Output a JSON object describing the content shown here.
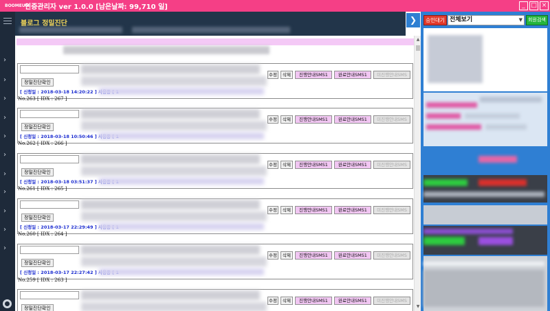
{
  "window": {
    "title": "인증관리자 ver 1.0.0 [남은날짜: 99,710 일]",
    "controls": {
      "minimize": "_",
      "maximize": "□",
      "close": "×"
    }
  },
  "logo": {
    "text": "BOOMEUM"
  },
  "header": {
    "title": "블로그 정밀진단"
  },
  "list": {
    "check_button_label": "정밀진단확인",
    "buttons": {
      "edit": "수정",
      "delete": "삭제",
      "progress_sms": "진행안내SMS1",
      "complete_sms": "완료안내SMS1",
      "disabled_sms": "미진행안내SMS"
    },
    "entries": [
      {
        "meta": "[ 신청일 : 2018-03-18 14:20:22 ] 사용종 [ 1",
        "no": "No.263 [ IDX : 267 ]"
      },
      {
        "meta": "[ 신청일 : 2018-03-18 10:50:46 ] 사용종 [ 1",
        "no": "No.262 [ IDX : 266 ]"
      },
      {
        "meta": "[ 신청일 : 2018-03-18 03:51:37 ] 사용종 [ 1",
        "no": "No.261 [ IDX : 265 ]"
      },
      {
        "meta": "[ 신청일 : 2018-03-17 22:29:49 ] 사용종 [ 1",
        "no": "No.260 [ IDX : 264 ]"
      },
      {
        "meta": "[ 신청일 : 2018-03-17 22:27:42 ] 사용종 [ 1",
        "no": "No.259 [ IDX : 263 ]"
      },
      {
        "meta": "",
        "no": ""
      }
    ]
  },
  "rightpanel": {
    "approve_label": "승인대기",
    "filter_value": "전체보기",
    "member_search_label": "회원검색",
    "expander": "❯"
  },
  "colors": {
    "titlebar": "#f53f86",
    "nav": "#1e2a3a",
    "header_title": "#f2d65a",
    "panel": "#2f7fd3",
    "sms_button": "#f1c6f2"
  },
  "icons": [
    "menu-icon",
    "chevron-right-icon",
    "gear-icon",
    "chevron-right-icon"
  ]
}
